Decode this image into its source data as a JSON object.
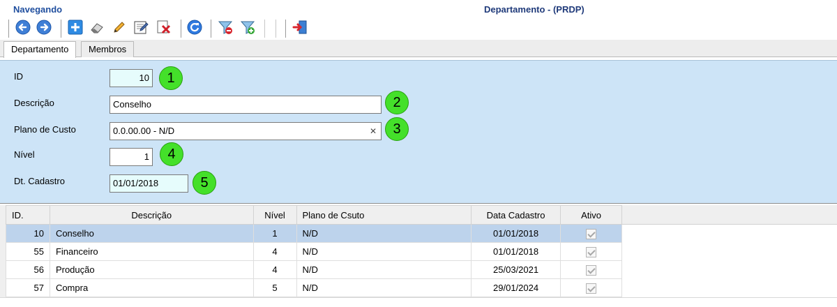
{
  "header": {
    "mode_label": "Navegando",
    "window_title": "Departamento - (PRDP)"
  },
  "toolbar": {
    "buttons": [
      {
        "icon": "back-arrow-icon"
      },
      {
        "icon": "forward-arrow-icon"
      },
      {
        "icon": "add-icon"
      },
      {
        "icon": "eraser-icon"
      },
      {
        "icon": "edit-pencil-icon"
      },
      {
        "icon": "edit-note-icon"
      },
      {
        "icon": "delete-icon"
      },
      {
        "icon": "refresh-icon"
      },
      {
        "icon": "filter-remove-icon"
      },
      {
        "icon": "filter-add-icon"
      },
      {
        "icon": "exit-icon"
      }
    ]
  },
  "tabs": [
    {
      "label": "Departamento",
      "active": true
    },
    {
      "label": "Membros",
      "active": false
    }
  ],
  "form": {
    "id_label": "ID",
    "id_value": "10",
    "descricao_label": "Descrição",
    "descricao_value": "Conselho",
    "plano_label": "Plano de Custo",
    "plano_value": "0.0.00.00 - N/D",
    "plano_clear": "✕",
    "nivel_label": "Nível",
    "nivel_value": "1",
    "dt_label": "Dt. Cadastro",
    "dt_value": "01/01/2018"
  },
  "badges": [
    "1",
    "2",
    "3",
    "4",
    "5"
  ],
  "colors": {
    "form_bg": "#cde4f7",
    "badge": "#44e02a",
    "selected_row": "#bdd3ec",
    "header_text": "#1f4e9e"
  },
  "grid": {
    "columns": [
      "ID.",
      "Descrição",
      "Nível",
      "Plano de Csuto",
      "Data Cadastro",
      "Ativo"
    ],
    "rows": [
      {
        "id": "10",
        "descricao": "Conselho",
        "nivel": "1",
        "plano": "N/D",
        "data": "01/01/2018",
        "ativo": true,
        "selected": true
      },
      {
        "id": "55",
        "descricao": "Financeiro",
        "nivel": "4",
        "plano": "N/D",
        "data": "01/01/2018",
        "ativo": true,
        "selected": false
      },
      {
        "id": "56",
        "descricao": "Produção",
        "nivel": "4",
        "plano": "N/D",
        "data": "25/03/2021",
        "ativo": true,
        "selected": false
      },
      {
        "id": "57",
        "descricao": "Compra",
        "nivel": "5",
        "plano": "N/D",
        "data": "29/01/2024",
        "ativo": true,
        "selected": false
      }
    ]
  }
}
